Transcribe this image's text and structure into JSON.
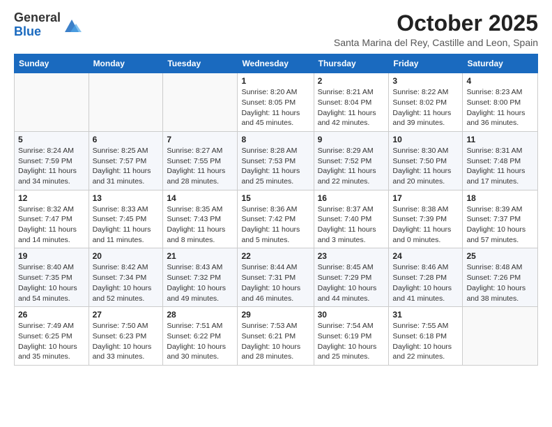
{
  "header": {
    "logo_general": "General",
    "logo_blue": "Blue",
    "month_title": "October 2025",
    "location": "Santa Marina del Rey, Castille and Leon, Spain"
  },
  "days_of_week": [
    "Sunday",
    "Monday",
    "Tuesday",
    "Wednesday",
    "Thursday",
    "Friday",
    "Saturday"
  ],
  "weeks": [
    [
      {
        "day": "",
        "info": ""
      },
      {
        "day": "",
        "info": ""
      },
      {
        "day": "",
        "info": ""
      },
      {
        "day": "1",
        "info": "Sunrise: 8:20 AM\nSunset: 8:05 PM\nDaylight: 11 hours and 45 minutes."
      },
      {
        "day": "2",
        "info": "Sunrise: 8:21 AM\nSunset: 8:04 PM\nDaylight: 11 hours and 42 minutes."
      },
      {
        "day": "3",
        "info": "Sunrise: 8:22 AM\nSunset: 8:02 PM\nDaylight: 11 hours and 39 minutes."
      },
      {
        "day": "4",
        "info": "Sunrise: 8:23 AM\nSunset: 8:00 PM\nDaylight: 11 hours and 36 minutes."
      }
    ],
    [
      {
        "day": "5",
        "info": "Sunrise: 8:24 AM\nSunset: 7:59 PM\nDaylight: 11 hours and 34 minutes."
      },
      {
        "day": "6",
        "info": "Sunrise: 8:25 AM\nSunset: 7:57 PM\nDaylight: 11 hours and 31 minutes."
      },
      {
        "day": "7",
        "info": "Sunrise: 8:27 AM\nSunset: 7:55 PM\nDaylight: 11 hours and 28 minutes."
      },
      {
        "day": "8",
        "info": "Sunrise: 8:28 AM\nSunset: 7:53 PM\nDaylight: 11 hours and 25 minutes."
      },
      {
        "day": "9",
        "info": "Sunrise: 8:29 AM\nSunset: 7:52 PM\nDaylight: 11 hours and 22 minutes."
      },
      {
        "day": "10",
        "info": "Sunrise: 8:30 AM\nSunset: 7:50 PM\nDaylight: 11 hours and 20 minutes."
      },
      {
        "day": "11",
        "info": "Sunrise: 8:31 AM\nSunset: 7:48 PM\nDaylight: 11 hours and 17 minutes."
      }
    ],
    [
      {
        "day": "12",
        "info": "Sunrise: 8:32 AM\nSunset: 7:47 PM\nDaylight: 11 hours and 14 minutes."
      },
      {
        "day": "13",
        "info": "Sunrise: 8:33 AM\nSunset: 7:45 PM\nDaylight: 11 hours and 11 minutes."
      },
      {
        "day": "14",
        "info": "Sunrise: 8:35 AM\nSunset: 7:43 PM\nDaylight: 11 hours and 8 minutes."
      },
      {
        "day": "15",
        "info": "Sunrise: 8:36 AM\nSunset: 7:42 PM\nDaylight: 11 hours and 5 minutes."
      },
      {
        "day": "16",
        "info": "Sunrise: 8:37 AM\nSunset: 7:40 PM\nDaylight: 11 hours and 3 minutes."
      },
      {
        "day": "17",
        "info": "Sunrise: 8:38 AM\nSunset: 7:39 PM\nDaylight: 11 hours and 0 minutes."
      },
      {
        "day": "18",
        "info": "Sunrise: 8:39 AM\nSunset: 7:37 PM\nDaylight: 10 hours and 57 minutes."
      }
    ],
    [
      {
        "day": "19",
        "info": "Sunrise: 8:40 AM\nSunset: 7:35 PM\nDaylight: 10 hours and 54 minutes."
      },
      {
        "day": "20",
        "info": "Sunrise: 8:42 AM\nSunset: 7:34 PM\nDaylight: 10 hours and 52 minutes."
      },
      {
        "day": "21",
        "info": "Sunrise: 8:43 AM\nSunset: 7:32 PM\nDaylight: 10 hours and 49 minutes."
      },
      {
        "day": "22",
        "info": "Sunrise: 8:44 AM\nSunset: 7:31 PM\nDaylight: 10 hours and 46 minutes."
      },
      {
        "day": "23",
        "info": "Sunrise: 8:45 AM\nSunset: 7:29 PM\nDaylight: 10 hours and 44 minutes."
      },
      {
        "day": "24",
        "info": "Sunrise: 8:46 AM\nSunset: 7:28 PM\nDaylight: 10 hours and 41 minutes."
      },
      {
        "day": "25",
        "info": "Sunrise: 8:48 AM\nSunset: 7:26 PM\nDaylight: 10 hours and 38 minutes."
      }
    ],
    [
      {
        "day": "26",
        "info": "Sunrise: 7:49 AM\nSunset: 6:25 PM\nDaylight: 10 hours and 35 minutes."
      },
      {
        "day": "27",
        "info": "Sunrise: 7:50 AM\nSunset: 6:23 PM\nDaylight: 10 hours and 33 minutes."
      },
      {
        "day": "28",
        "info": "Sunrise: 7:51 AM\nSunset: 6:22 PM\nDaylight: 10 hours and 30 minutes."
      },
      {
        "day": "29",
        "info": "Sunrise: 7:53 AM\nSunset: 6:21 PM\nDaylight: 10 hours and 28 minutes."
      },
      {
        "day": "30",
        "info": "Sunrise: 7:54 AM\nSunset: 6:19 PM\nDaylight: 10 hours and 25 minutes."
      },
      {
        "day": "31",
        "info": "Sunrise: 7:55 AM\nSunset: 6:18 PM\nDaylight: 10 hours and 22 minutes."
      },
      {
        "day": "",
        "info": ""
      }
    ]
  ]
}
